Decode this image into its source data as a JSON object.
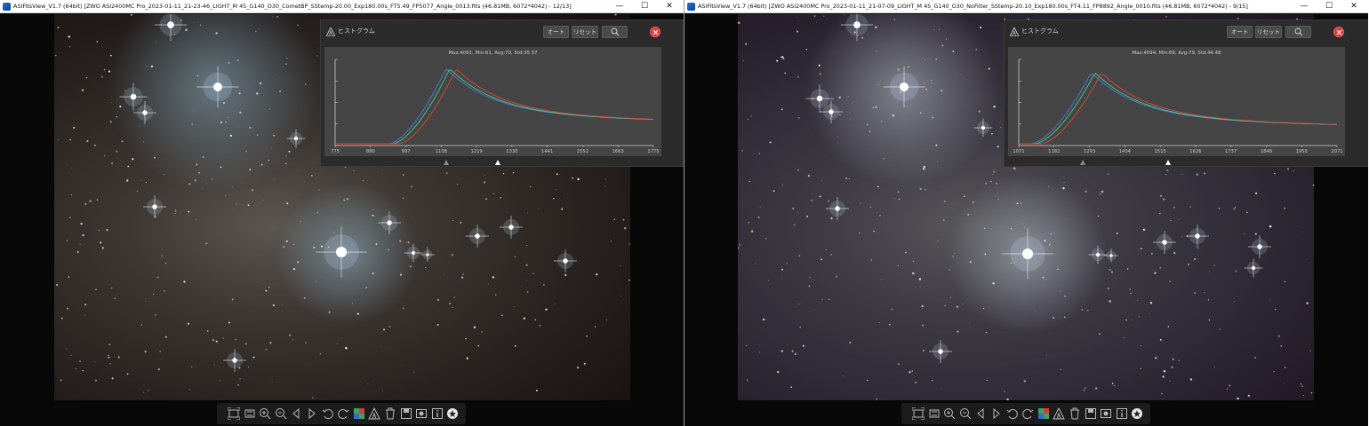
{
  "windows": [
    {
      "title": "ASIFitsView_V1.7 (64bit) [ZWO ASI2400MC Pro_2023-01-11_21-23-46_LIGHT_M 45_G140_O30_CometBP_SStemp-20.00_Exp180.00s_FT5.49_FP5077_Angle_0013.fits (46.81MB, 6072*4042) - 12/13]",
      "controls": {
        "minimize": "—",
        "maximize": "☐",
        "close": "✕"
      },
      "image": {
        "name": "M45 LIGHT frame (CometBP)",
        "tint": "warm"
      },
      "histogram": {
        "title": "ヒストグラム",
        "auto_label": "オート",
        "reset_label": "リセット",
        "zoom_icon": "magnifier-icon",
        "stats": "Max:4091, Min:61, Avg:70, Std:35.37",
        "xticks": [
          "775",
          "886",
          "997",
          "1108",
          "1219",
          "1330",
          "1441",
          "1552",
          "1663",
          "1775"
        ],
        "black_point_frac": 0.35,
        "white_point_frac": 0.51,
        "colors": {
          "red": "#e0463f",
          "green": "#3fd27c",
          "blue": "#4d79e6"
        }
      },
      "toolbar": [
        "fit-icon",
        "actual-size-icon",
        "zoom-in-icon",
        "zoom-out-icon",
        "prev-icon",
        "next-icon",
        "rotate-left-icon",
        "rotate-right-icon",
        "debayer-icon",
        "histogram-icon",
        "delete-icon",
        "save-icon",
        "compare-icon",
        "info-icon",
        "star-icon"
      ]
    },
    {
      "title": "ASIFitsView_V1.7 (64bit) [ZWO ASI2400MC Pro_2023-01-11_21-07-09_LIGHT_M 45_G140_O30_NoFilter_SStemp-20.10_Exp180.00s_FT4.11_FP8892_Angle_0010.fits (46.81MB, 6072*4042) - 9/15]",
      "controls": {
        "minimize": "—",
        "maximize": "☐",
        "close": "✕"
      },
      "image": {
        "name": "M45 LIGHT frame (NoFilter)",
        "tint": "neutral"
      },
      "histogram": {
        "title": "ヒストグラム",
        "auto_label": "オート",
        "reset_label": "リセット",
        "zoom_icon": "magnifier-icon",
        "stats": "Max:4094, Min:69, Avg:79, Std:44.48",
        "xticks": [
          "1071",
          "1182",
          "1293",
          "1404",
          "1515",
          "1626",
          "1737",
          "1848",
          "1959",
          "2071"
        ],
        "black_point_frac": 0.2,
        "white_point_frac": 0.47,
        "colors": {
          "red": "#e0463f",
          "green": "#3fd27c",
          "blue": "#4d79e6"
        }
      },
      "toolbar": [
        "fit-icon",
        "actual-size-icon",
        "zoom-in-icon",
        "zoom-out-icon",
        "prev-icon",
        "next-icon",
        "rotate-left-icon",
        "rotate-right-icon",
        "debayer-icon",
        "histogram-icon",
        "delete-icon",
        "save-icon",
        "compare-icon",
        "info-icon",
        "star-icon"
      ]
    }
  ]
}
